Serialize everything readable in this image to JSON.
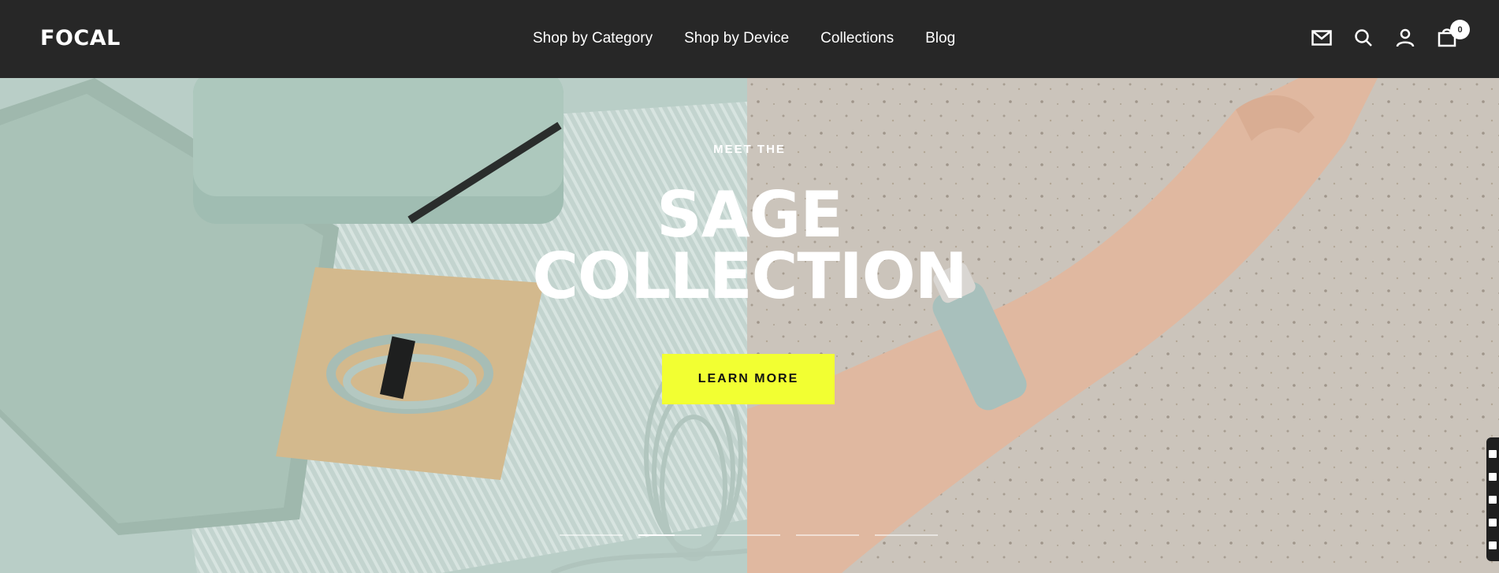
{
  "brand": {
    "logo_text": "FOCAL"
  },
  "nav": {
    "items": [
      {
        "label": "Shop by Category"
      },
      {
        "label": "Shop by Device"
      },
      {
        "label": "Collections"
      },
      {
        "label": "Blog"
      }
    ]
  },
  "header_icons": {
    "icons": [
      "mail-icon",
      "search-icon",
      "account-icon",
      "cart-icon"
    ],
    "cart_count": "0"
  },
  "hero": {
    "eyebrow": "MEET THE",
    "title_line1": "SAGE",
    "title_line2": "COLLECTION",
    "cta_label": "LEARN MORE",
    "slides": [
      {
        "active": false
      },
      {
        "active": true
      },
      {
        "active": false
      },
      {
        "active": false
      },
      {
        "active": false
      }
    ]
  },
  "colors": {
    "header_bg": "#272727",
    "cta_bg": "#f2ff32",
    "left_panel_bg": "#bcd0ca",
    "right_panel_bg": "#c9c2b9"
  }
}
